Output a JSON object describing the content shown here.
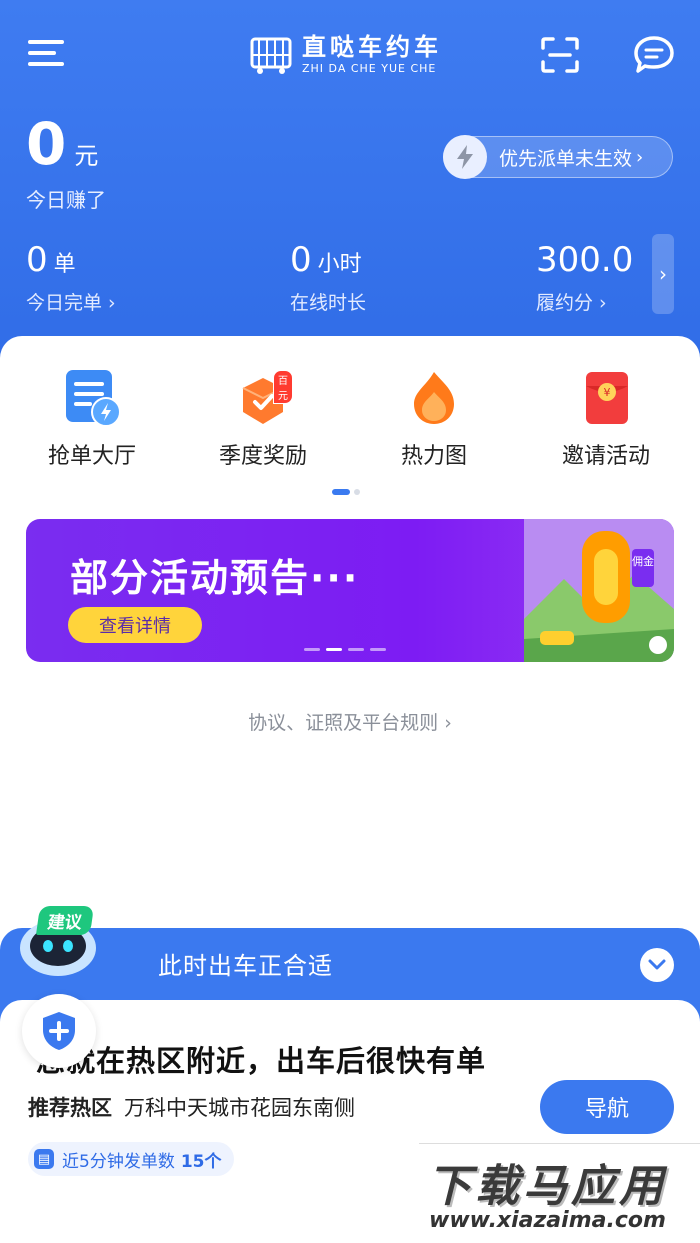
{
  "app": {
    "logo_title": "直哒车约车",
    "logo_subtitle": "ZHI DA CHE YUE CHE"
  },
  "colors": {
    "primary": "#3b79ef",
    "badge": "#ff3b30",
    "banner": "#7d1cf3",
    "banner_button": "#ffd43b",
    "suggest": "#1ec77e"
  },
  "earnings": {
    "amount": "0",
    "unit": "元",
    "label": "今日赚了"
  },
  "priority": {
    "label": "优先派单未生效",
    "chevron": "›"
  },
  "stats": [
    {
      "value": "0",
      "unit": "单",
      "label": "今日完单 ›"
    },
    {
      "value": "0",
      "unit": "小时",
      "label": "在线时长"
    },
    {
      "value": "300.0",
      "unit": "",
      "label": "履约分 ›"
    }
  ],
  "stats_more": "›",
  "menu": [
    {
      "label": "抢单大厅",
      "icon": "order-hall-icon"
    },
    {
      "label": "季度奖励",
      "icon": "reward-icon",
      "badge": "百元"
    },
    {
      "label": "热力图",
      "icon": "heatmap-icon"
    },
    {
      "label": "邀请活动",
      "icon": "invite-icon"
    }
  ],
  "banner": {
    "title": "部分活动预告···",
    "button": "查看详情",
    "art_label": "佣金"
  },
  "rules_link": "协议、证照及平台规则 ›",
  "suggestion": {
    "tag": "建议",
    "title": "此时出车正合适",
    "headline": "您就在热区附近，出车后很快有单",
    "hotspot_label": "推荐热区",
    "hotspot_value": "万科中天城市花园东南侧",
    "nav_button": "导航",
    "orders_text": "近5分钟发单数",
    "orders_count": "15个"
  },
  "watermark": {
    "main": "下载马应用",
    "url": "www.xiazaima.com"
  }
}
